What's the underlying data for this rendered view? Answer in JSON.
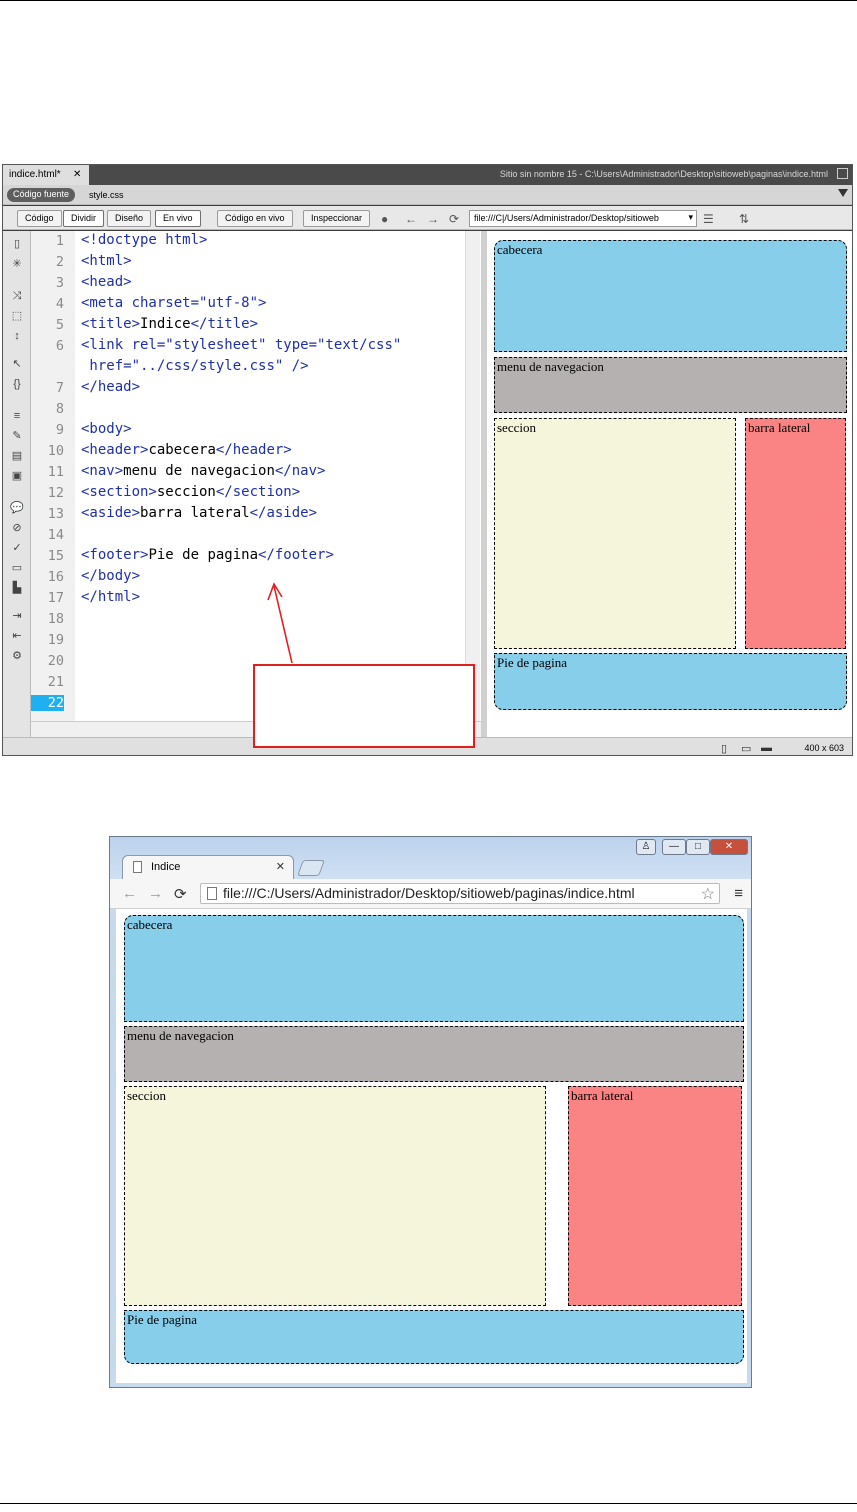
{
  "dreamweaver": {
    "doc_tab": "indice.html*",
    "tab_close": "✕",
    "site_path": "Sitio sin nombre 15 - C:\\Users\\Administrador\\Desktop\\sitioweb\\paginas\\indice.html",
    "related_files": {
      "source_label": "Código fuente",
      "file": "style.css"
    },
    "toolbar": {
      "codigo": "Código",
      "dividir": "Dividir",
      "diseno": "Diseño",
      "en_vivo": "En vivo",
      "codigo_en_vivo": "Código en vivo",
      "inspeccionar": "Inspeccionar",
      "address": "file:///C|/Users/Administrador/Desktop/sitioweb"
    },
    "line_numbers": [
      "1",
      "2",
      "3",
      "4",
      "5",
      "6",
      "",
      "7",
      "8",
      "9",
      "10",
      "11",
      "12",
      "13",
      "14",
      "15",
      "16",
      "17",
      "18",
      "19",
      "20",
      "21",
      "22"
    ],
    "current_line": "22",
    "code": {
      "l1": "<!doctype html>",
      "l2": "<html>",
      "l3": "<head>",
      "l4a": "<meta ",
      "l4b": "charset=",
      "l4c": "\"utf-8\"",
      "l4d": ">",
      "l5a": "<title>",
      "l5b": "Indice",
      "l5c": "</title>",
      "l6a": "<link ",
      "l6b": "rel=",
      "l6c": "\"stylesheet\"",
      "l6d": " type=",
      "l6e": "\"text/css\"",
      "l6f": " href=",
      "l6g": "\"../css/style.css\"",
      "l6h": " />",
      "l7": "</head>",
      "l9": "<body>",
      "l10a": "<header>",
      "l10b": "cabecera",
      "l10c": "</header>",
      "l11a": "<nav>",
      "l11b": "menu de navegacion",
      "l11c": "</nav>",
      "l12a": "<section>",
      "l12b": "seccion",
      "l12c": "</section>",
      "l13a": "<aside>",
      "l13b": "barra lateral",
      "l13c": "</aside>",
      "l15a": "<footer>",
      "l15b": "Pie de pagina",
      "l15c": "</footer>",
      "l16": "</body>",
      "l17": "</html>"
    },
    "status_size": "400 x 603"
  },
  "layout_boxes": {
    "header": "cabecera",
    "nav": "menu de navegacion",
    "section": "seccion",
    "aside": "barra lateral",
    "footer": "Pie de pagina"
  },
  "browser": {
    "tab_title": "Indice",
    "tab_close": "✕",
    "url": "file:///C:/Users/Administrador/Desktop/sitioweb/paginas/indice.html",
    "window_buttons": {
      "minimize": "—",
      "maximize": "□",
      "close": "✕"
    }
  },
  "colors": {
    "header_footer": "#87ceeb",
    "nav": "#b6b1b1",
    "section": "#f5f5dc",
    "aside": "#fa8383",
    "annotation": "#e02020",
    "current_line": "#1fb0f0"
  }
}
